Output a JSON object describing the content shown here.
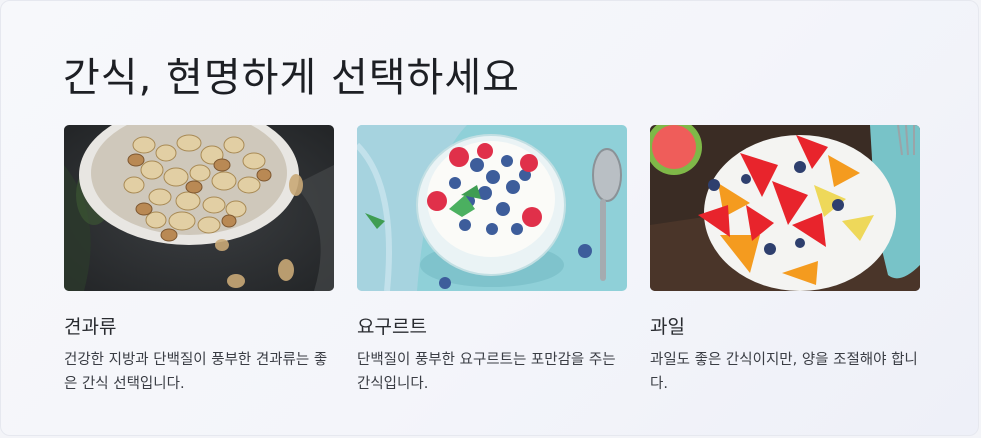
{
  "page": {
    "title": "간식, 현명하게 선택하세요"
  },
  "cards": [
    {
      "name": "견과류",
      "description": "건강한 지방과 단백질이 풍부한 견과류는 좋은 간식 선택입니다."
    },
    {
      "name": "요구르트",
      "description": "단백질이 풍부한 요구르트는 포만감을 주는 간식입니다."
    },
    {
      "name": "과일",
      "description": "과일도 좋은 간식이지만, 양을 조절해야 합니다."
    }
  ]
}
